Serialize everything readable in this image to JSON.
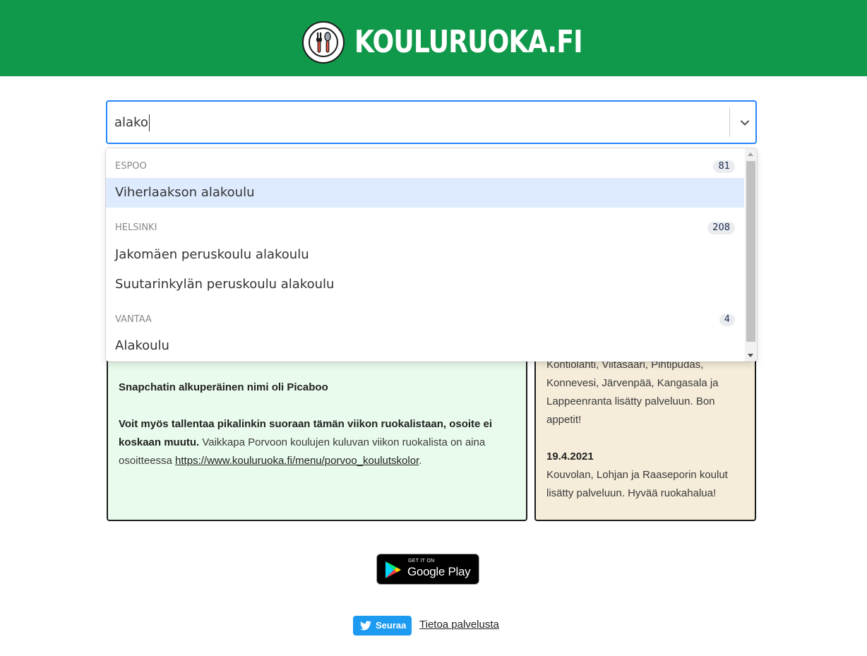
{
  "header": {
    "site_name": "KOULURUOKA.FI",
    "bg_color": "#11994b",
    "logo_icon": "fork-spoon-icon"
  },
  "search": {
    "value": "alako",
    "chevron_icon": "chevron-down-icon",
    "focus_color": "#2684ff"
  },
  "dropdown": {
    "groups": [
      {
        "label": "ESPOO",
        "count": "81",
        "options": [
          "Viherlaakson alakoulu"
        ]
      },
      {
        "label": "HELSINKI",
        "count": "208",
        "options": [
          "Jakomäen peruskoulu alakoulu",
          "Suutarinkylän peruskoulu alakoulu"
        ]
      },
      {
        "label": "VANTAA",
        "count": "4",
        "options": [
          "Alakoulu"
        ]
      }
    ],
    "focused_option": "Viherlaakson alakoulu",
    "focused_color": "#deebff"
  },
  "fact_panel": {
    "fact": "Snapchatin alkuperäinen nimi oli Picaboo",
    "tip_bold": "Voit myös tallentaa pikalinkin suoraan tämän viikon ruokalistaan, osoite ei koskaan muutu.",
    "tip_text": " Vaikkapa Porvoon koulujen kuluvan viikon ruokalista on aina osoitteessa ",
    "tip_link": "https://www.kouluruoka.fi/menu/porvoo_koulutskolor",
    "tip_end": ".",
    "bg_color": "#e9fbec"
  },
  "news_panel": {
    "partial_text": "Kontiolahti, Viitasaari, Pihtipudas, Konnevesi, Järvenpää, Kangasala ja Lappeenranta lisätty palveluun. Bon appetit!",
    "date": "19.4.2021",
    "text": "Kouvolan, Lohjan ja Raaseporin koulut lisätty palveluun. Hyvää ruokahalua!",
    "bg_color": "#f5ecd9"
  },
  "google_play": {
    "small": "GET IT ON",
    "big": "Google Play"
  },
  "footer": {
    "twitter_label": "Seuraa",
    "twitter_color": "#1d9bf0",
    "about_link": "Tietoa palvelusta"
  }
}
